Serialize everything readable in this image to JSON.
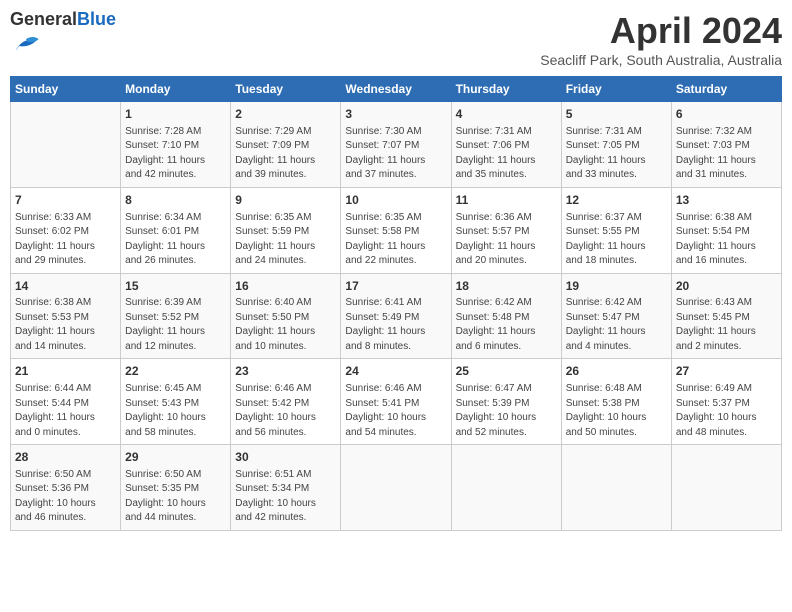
{
  "header": {
    "logo_general": "General",
    "logo_blue": "Blue",
    "month_title": "April 2024",
    "location": "Seacliff Park, South Australia, Australia"
  },
  "days_of_week": [
    "Sunday",
    "Monday",
    "Tuesday",
    "Wednesday",
    "Thursday",
    "Friday",
    "Saturday"
  ],
  "weeks": [
    [
      {
        "day": "",
        "info": ""
      },
      {
        "day": "1",
        "info": "Sunrise: 7:28 AM\nSunset: 7:10 PM\nDaylight: 11 hours\nand 42 minutes."
      },
      {
        "day": "2",
        "info": "Sunrise: 7:29 AM\nSunset: 7:09 PM\nDaylight: 11 hours\nand 39 minutes."
      },
      {
        "day": "3",
        "info": "Sunrise: 7:30 AM\nSunset: 7:07 PM\nDaylight: 11 hours\nand 37 minutes."
      },
      {
        "day": "4",
        "info": "Sunrise: 7:31 AM\nSunset: 7:06 PM\nDaylight: 11 hours\nand 35 minutes."
      },
      {
        "day": "5",
        "info": "Sunrise: 7:31 AM\nSunset: 7:05 PM\nDaylight: 11 hours\nand 33 minutes."
      },
      {
        "day": "6",
        "info": "Sunrise: 7:32 AM\nSunset: 7:03 PM\nDaylight: 11 hours\nand 31 minutes."
      }
    ],
    [
      {
        "day": "7",
        "info": "Sunrise: 6:33 AM\nSunset: 6:02 PM\nDaylight: 11 hours\nand 29 minutes."
      },
      {
        "day": "8",
        "info": "Sunrise: 6:34 AM\nSunset: 6:01 PM\nDaylight: 11 hours\nand 26 minutes."
      },
      {
        "day": "9",
        "info": "Sunrise: 6:35 AM\nSunset: 5:59 PM\nDaylight: 11 hours\nand 24 minutes."
      },
      {
        "day": "10",
        "info": "Sunrise: 6:35 AM\nSunset: 5:58 PM\nDaylight: 11 hours\nand 22 minutes."
      },
      {
        "day": "11",
        "info": "Sunrise: 6:36 AM\nSunset: 5:57 PM\nDaylight: 11 hours\nand 20 minutes."
      },
      {
        "day": "12",
        "info": "Sunrise: 6:37 AM\nSunset: 5:55 PM\nDaylight: 11 hours\nand 18 minutes."
      },
      {
        "day": "13",
        "info": "Sunrise: 6:38 AM\nSunset: 5:54 PM\nDaylight: 11 hours\nand 16 minutes."
      }
    ],
    [
      {
        "day": "14",
        "info": "Sunrise: 6:38 AM\nSunset: 5:53 PM\nDaylight: 11 hours\nand 14 minutes."
      },
      {
        "day": "15",
        "info": "Sunrise: 6:39 AM\nSunset: 5:52 PM\nDaylight: 11 hours\nand 12 minutes."
      },
      {
        "day": "16",
        "info": "Sunrise: 6:40 AM\nSunset: 5:50 PM\nDaylight: 11 hours\nand 10 minutes."
      },
      {
        "day": "17",
        "info": "Sunrise: 6:41 AM\nSunset: 5:49 PM\nDaylight: 11 hours\nand 8 minutes."
      },
      {
        "day": "18",
        "info": "Sunrise: 6:42 AM\nSunset: 5:48 PM\nDaylight: 11 hours\nand 6 minutes."
      },
      {
        "day": "19",
        "info": "Sunrise: 6:42 AM\nSunset: 5:47 PM\nDaylight: 11 hours\nand 4 minutes."
      },
      {
        "day": "20",
        "info": "Sunrise: 6:43 AM\nSunset: 5:45 PM\nDaylight: 11 hours\nand 2 minutes."
      }
    ],
    [
      {
        "day": "21",
        "info": "Sunrise: 6:44 AM\nSunset: 5:44 PM\nDaylight: 11 hours\nand 0 minutes."
      },
      {
        "day": "22",
        "info": "Sunrise: 6:45 AM\nSunset: 5:43 PM\nDaylight: 10 hours\nand 58 minutes."
      },
      {
        "day": "23",
        "info": "Sunrise: 6:46 AM\nSunset: 5:42 PM\nDaylight: 10 hours\nand 56 minutes."
      },
      {
        "day": "24",
        "info": "Sunrise: 6:46 AM\nSunset: 5:41 PM\nDaylight: 10 hours\nand 54 minutes."
      },
      {
        "day": "25",
        "info": "Sunrise: 6:47 AM\nSunset: 5:39 PM\nDaylight: 10 hours\nand 52 minutes."
      },
      {
        "day": "26",
        "info": "Sunrise: 6:48 AM\nSunset: 5:38 PM\nDaylight: 10 hours\nand 50 minutes."
      },
      {
        "day": "27",
        "info": "Sunrise: 6:49 AM\nSunset: 5:37 PM\nDaylight: 10 hours\nand 48 minutes."
      }
    ],
    [
      {
        "day": "28",
        "info": "Sunrise: 6:50 AM\nSunset: 5:36 PM\nDaylight: 10 hours\nand 46 minutes."
      },
      {
        "day": "29",
        "info": "Sunrise: 6:50 AM\nSunset: 5:35 PM\nDaylight: 10 hours\nand 44 minutes."
      },
      {
        "day": "30",
        "info": "Sunrise: 6:51 AM\nSunset: 5:34 PM\nDaylight: 10 hours\nand 42 minutes."
      },
      {
        "day": "",
        "info": ""
      },
      {
        "day": "",
        "info": ""
      },
      {
        "day": "",
        "info": ""
      },
      {
        "day": "",
        "info": ""
      }
    ]
  ]
}
